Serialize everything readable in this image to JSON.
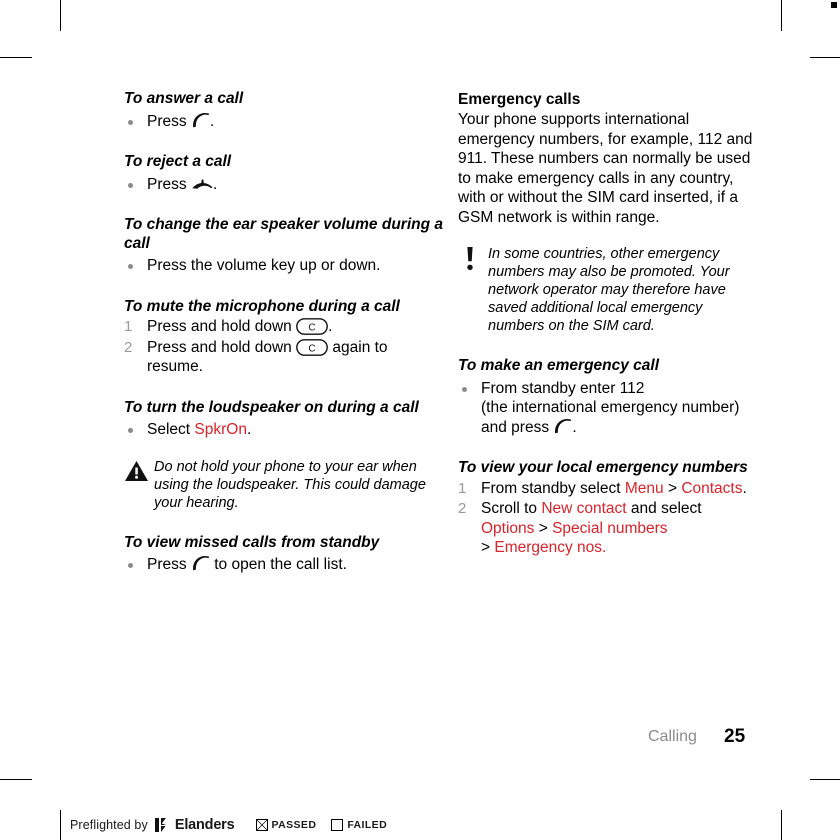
{
  "document": {
    "chapter": "Calling",
    "page_number": "25"
  },
  "left_column": {
    "tasks": [
      {
        "heading": "To answer a call",
        "steps": [
          {
            "marker": "bullet",
            "text_before": "Press ",
            "icon": "call-key-icon",
            "text_after": "."
          }
        ]
      },
      {
        "heading": "To reject a call",
        "steps": [
          {
            "marker": "bullet",
            "text_before": "Press ",
            "icon": "end-call-key-icon",
            "text_after": "."
          }
        ]
      },
      {
        "heading": "To change the ear speaker volume during a call",
        "steps": [
          {
            "marker": "bullet",
            "text": "Press the volume key up or down."
          }
        ]
      },
      {
        "heading": "To mute the microphone during a call",
        "steps": [
          {
            "marker": "1",
            "text_before": "Press and hold down ",
            "icon": "clear-key-c",
            "text_after": "."
          },
          {
            "marker": "2",
            "text_before": "Press and hold down ",
            "icon": "clear-key-c",
            "text_after": " again to resume."
          }
        ]
      },
      {
        "heading": "To turn the loudspeaker on during a call",
        "steps": [
          {
            "marker": "bullet",
            "text_before": "Select ",
            "ui_term": "SpkrOn",
            "text_after": "."
          }
        ]
      }
    ],
    "warning_note": {
      "icon": "warning-triangle-icon",
      "text": "Do not hold your phone to your ear when using the loudspeaker. This could damage your hearing."
    },
    "last_task": {
      "heading": "To view missed calls from standby",
      "step_before": "Press ",
      "step_icon": "call-key-icon",
      "step_after": " to open the call list."
    }
  },
  "right_column": {
    "section_heading": "Emergency calls",
    "intro_paragraph": "Your phone supports international emergency numbers, for example, 112 and 911. These numbers can normally be used to make emergency calls in any country, with or without the SIM card inserted, if a GSM network is within range.",
    "info_note": {
      "icon": "exclamation-note-icon",
      "text": "In some countries, other emergency numbers may also be promoted. Your network operator may therefore have saved additional local emergency numbers on the SIM card."
    },
    "task_emergency_call": {
      "heading": "To make an emergency call",
      "step_line1": "From standby enter 112",
      "step_line2": "(the international emergency number)",
      "step_line3_before": "and press ",
      "step_line3_icon": "call-key-icon",
      "step_line3_after": "."
    },
    "task_local_numbers": {
      "heading": "To view your local emergency numbers",
      "steps": [
        {
          "marker": "1",
          "prefix": "From standby select ",
          "terms": [
            "Menu",
            "Contacts"
          ],
          "suffix": "."
        },
        {
          "marker": "2",
          "prefix": "Scroll to ",
          "term1": "New contact",
          "mid": " and select ",
          "term2": "Options",
          "term3": "Special numbers",
          "term4": "Emergency nos.",
          "separator": ">"
        }
      ]
    }
  },
  "preflight_bar": {
    "label": "Preflighted by",
    "brand": "Elanders",
    "passed_label": "PASSED",
    "failed_label": "FAILED",
    "passed_checked": true,
    "failed_checked": false
  },
  "colors": {
    "ui_term_red": "#D8242C",
    "chapter_gray": "#8c8c8c",
    "bullet_gray": "#8a8a8a",
    "number_gray": "#9a9a9a"
  }
}
